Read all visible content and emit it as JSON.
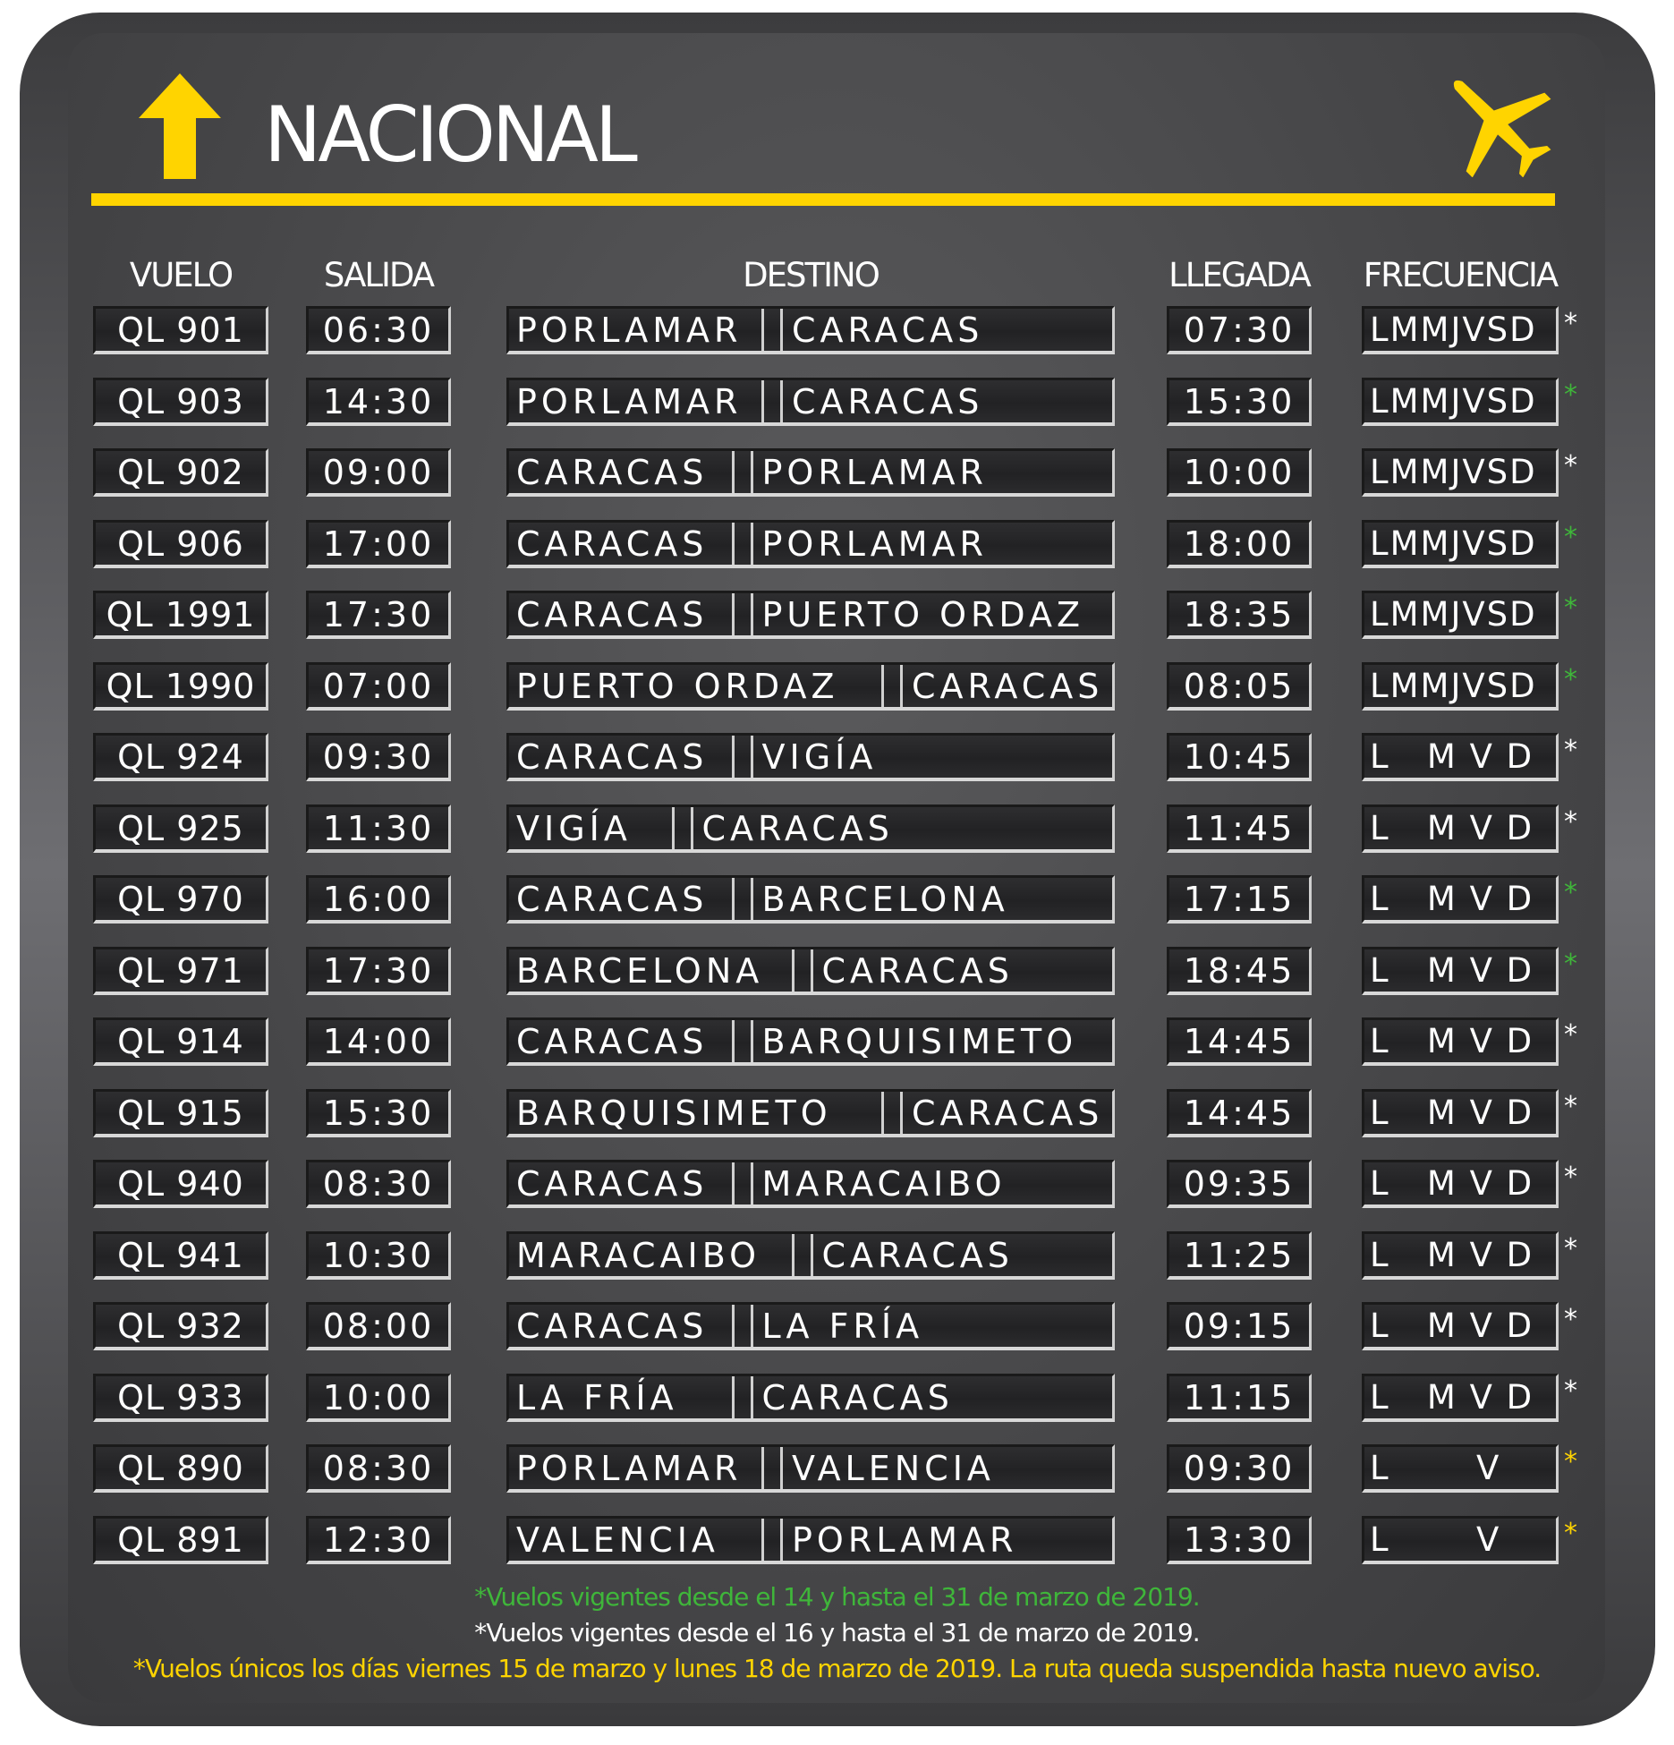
{
  "board": {
    "title": "NACIONAL",
    "accent_color": "#ffd400",
    "icons": [
      "arrow-up-icon",
      "airplane-icon"
    ]
  },
  "headers": {
    "flight": "VUELO",
    "departure": "SALIDA",
    "destination": "DESTINO",
    "arrival": "LLEGADA",
    "frequency": "FRECUENCIA"
  },
  "flights": [
    {
      "flight": "QL 901",
      "dep": "06:30",
      "from": "PORLAMAR",
      "to": "CARACAS",
      "arr": "07:30",
      "freq": "LMMJVSD",
      "mark": "*",
      "mark_color": "#ffffff"
    },
    {
      "flight": "QL 903",
      "dep": "14:30",
      "from": "PORLAMAR",
      "to": "CARACAS",
      "arr": "15:30",
      "freq": "LMMJVSD",
      "mark": "*",
      "mark_color": "#3fb63a"
    },
    {
      "flight": "QL 902",
      "dep": "09:00",
      "from": "CARACAS",
      "to": "PORLAMAR",
      "arr": "10:00",
      "freq": "LMMJVSD",
      "mark": "*",
      "mark_color": "#ffffff"
    },
    {
      "flight": "QL 906",
      "dep": "17:00",
      "from": "CARACAS",
      "to": "PORLAMAR",
      "arr": "18:00",
      "freq": "LMMJVSD",
      "mark": "*",
      "mark_color": "#3fb63a"
    },
    {
      "flight": "QL 1991",
      "dep": "17:30",
      "from": "CARACAS",
      "to": "PUERTO ORDAZ",
      "arr": "18:35",
      "freq": "LMMJVSD",
      "mark": "*",
      "mark_color": "#3fb63a"
    },
    {
      "flight": "QL 1990",
      "dep": "07:00",
      "from": "PUERTO ORDAZ",
      "to": "CARACAS",
      "arr": "08:05",
      "freq": "LMMJVSD",
      "mark": "*",
      "mark_color": "#3fb63a"
    },
    {
      "flight": "QL 924",
      "dep": "09:30",
      "from": "CARACAS",
      "to": "VIGÍA",
      "arr": "10:45",
      "freq": "L   M V D",
      "mark": "*",
      "mark_color": "#ffffff"
    },
    {
      "flight": "QL 925",
      "dep": "11:30",
      "from": "VIGÍA",
      "to": "CARACAS",
      "arr": "11:45",
      "freq": "L   M V D",
      "mark": "*",
      "mark_color": "#ffffff"
    },
    {
      "flight": "QL 970",
      "dep": "16:00",
      "from": "CARACAS",
      "to": "BARCELONA",
      "arr": "17:15",
      "freq": "L   M V D",
      "mark": "*",
      "mark_color": "#3fb63a"
    },
    {
      "flight": "QL 971",
      "dep": "17:30",
      "from": "BARCELONA",
      "to": "CARACAS",
      "arr": "18:45",
      "freq": "L   M V D",
      "mark": "*",
      "mark_color": "#3fb63a"
    },
    {
      "flight": "QL 914",
      "dep": "14:00",
      "from": "CARACAS",
      "to": "BARQUISIMETO",
      "arr": "14:45",
      "freq": "L   M V D",
      "mark": "*",
      "mark_color": "#ffffff"
    },
    {
      "flight": "QL 915",
      "dep": "15:30",
      "from": "BARQUISIMETO",
      "to": "CARACAS",
      "arr": "14:45",
      "freq": "L   M V D",
      "mark": "*",
      "mark_color": "#ffffff"
    },
    {
      "flight": "QL 940",
      "dep": "08:30",
      "from": "CARACAS",
      "to": "MARACAIBO",
      "arr": "09:35",
      "freq": "L   M V D",
      "mark": "*",
      "mark_color": "#ffffff"
    },
    {
      "flight": "QL 941",
      "dep": "10:30",
      "from": "MARACAIBO",
      "to": "CARACAS",
      "arr": "11:25",
      "freq": "L   M V D",
      "mark": "*",
      "mark_color": "#ffffff"
    },
    {
      "flight": "QL 932",
      "dep": "08:00",
      "from": "CARACAS",
      "to": "LA FRÍA",
      "arr": "09:15",
      "freq": "L   M V D",
      "mark": "*",
      "mark_color": "#ffffff"
    },
    {
      "flight": "QL 933",
      "dep": "10:00",
      "from": "LA FRÍA",
      "to": "CARACAS",
      "arr": "11:15",
      "freq": "L   M V D",
      "mark": "*",
      "mark_color": "#ffffff"
    },
    {
      "flight": "QL 890",
      "dep": "08:30",
      "from": "PORLAMAR",
      "to": "VALENCIA",
      "arr": "09:30",
      "freq": "L       V",
      "mark": "*",
      "mark_color": "#ffd400"
    },
    {
      "flight": "QL 891",
      "dep": "12:30",
      "from": "VALENCIA",
      "to": "PORLAMAR",
      "arr": "13:30",
      "freq": "L       V",
      "mark": "*",
      "mark_color": "#ffd400"
    }
  ],
  "notes": [
    {
      "text": "*Vuelos vigentes desde el 14 y hasta el 31 de marzo de 2019.",
      "color": "#3fb63a"
    },
    {
      "text": "*Vuelos vigentes desde el 16 y hasta el 31 de marzo de 2019.",
      "color": "#ffffff"
    },
    {
      "text": "*Vuelos únicos los días viernes 15 de marzo y lunes 18 de marzo de 2019. La ruta queda suspendida hasta nuevo aviso.",
      "color": "#ffd400"
    }
  ]
}
